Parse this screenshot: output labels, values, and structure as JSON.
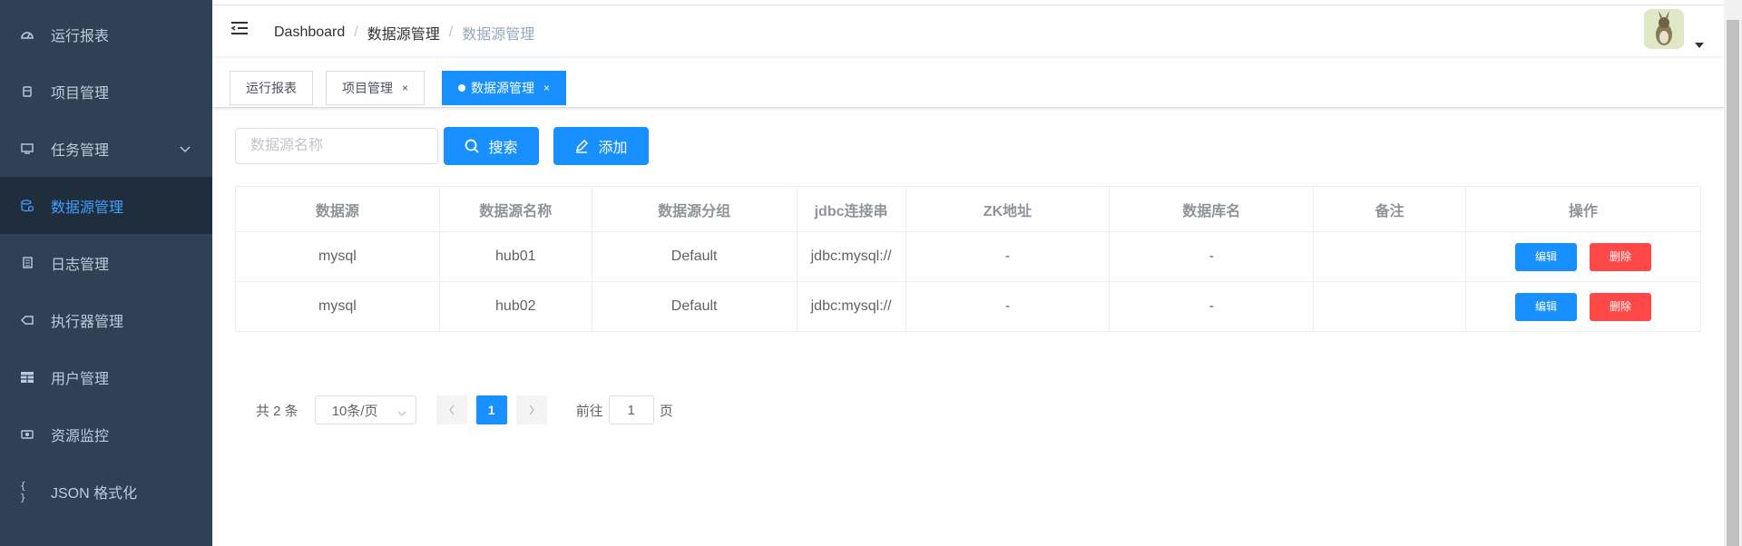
{
  "sidebar": {
    "items": [
      {
        "label": "运行报表",
        "icon": "dashboard-icon"
      },
      {
        "label": "项目管理",
        "icon": "project-icon"
      },
      {
        "label": "任务管理",
        "icon": "monitor-icon",
        "has_submenu": true
      },
      {
        "label": "数据源管理",
        "icon": "database-icon",
        "active": true
      },
      {
        "label": "日志管理",
        "icon": "document-icon"
      },
      {
        "label": "执行器管理",
        "icon": "executor-icon"
      },
      {
        "label": "用户管理",
        "icon": "table-icon"
      },
      {
        "label": "资源监控",
        "icon": "monitor-resource-icon"
      },
      {
        "label": "JSON 格式化",
        "icon": "braces-icon"
      }
    ]
  },
  "breadcrumb": [
    "Dashboard",
    "数据源管理",
    "数据源管理"
  ],
  "tags": [
    {
      "label": "运行报表",
      "closable": false,
      "active": false
    },
    {
      "label": "项目管理",
      "closable": true,
      "active": false
    },
    {
      "label": "数据源管理",
      "closable": true,
      "active": true
    }
  ],
  "tag_close": "×",
  "filter": {
    "search_placeholder": "数据源名称",
    "search_label": "搜索",
    "add_label": "添加"
  },
  "table": {
    "headers": [
      "数据源",
      "数据源名称",
      "数据源分组",
      "jdbc连接串",
      "ZK地址",
      "数据库名",
      "备注",
      "操作"
    ],
    "rows": [
      [
        "mysql",
        "hub01",
        "Default",
        "jdbc:mysql://",
        "-",
        "-",
        ""
      ],
      [
        "mysql",
        "hub02",
        "Default",
        "jdbc:mysql://",
        "-",
        "-",
        ""
      ]
    ],
    "edit_label": "编辑",
    "delete_label": "删除"
  },
  "pagination": {
    "total_text": "共 2 条",
    "page_size": "10条/页",
    "current_page": "1",
    "goto_prefix": "前往",
    "goto_value": "1",
    "goto_suffix": "页"
  },
  "colors": {
    "sidebar_bg": "#304156",
    "accent": "#1890ff",
    "danger": "#ff4949"
  }
}
